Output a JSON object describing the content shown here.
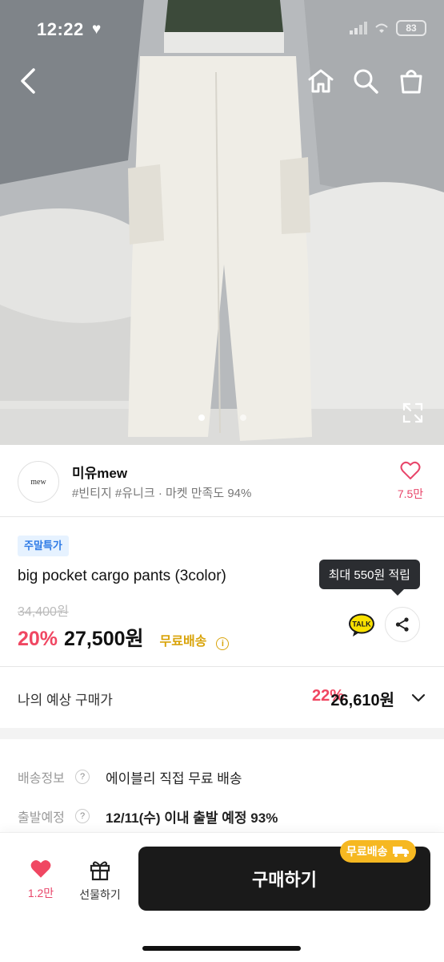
{
  "status_bar": {
    "time": "12:22",
    "battery": "83"
  },
  "seller": {
    "logo_text": "mew",
    "name": "미유mew",
    "tags": "#빈티지 #유니크 · 마켓 만족도 94%",
    "like_count": "7.5만"
  },
  "product": {
    "badge": "주말특가",
    "title": "big pocket cargo pants (3color)",
    "original_price": "34,400원",
    "discount": "20%",
    "price": "27,500원",
    "shipping_tag": "무료배송",
    "tooltip": "최대 550원 적립",
    "talk_label": "TALK"
  },
  "expected_price": {
    "label": "나의 예상 구매가",
    "discount": "22%",
    "price": "26,610원"
  },
  "shipping": [
    {
      "label": "배송정보",
      "value": "에이블리 직접 무료 배송"
    },
    {
      "label": "출발예정",
      "value": "12/11(수) 이내 출발 예정 93%"
    }
  ],
  "bottom_bar": {
    "like_count": "1.2만",
    "gift_label": "선물하기",
    "buy_label": "구매하기",
    "free_badge": "무료배송"
  },
  "colors": {
    "accent_pink": "#f04762",
    "badge_blue": "#2f7be6",
    "shipping_gold": "#d9a40b",
    "button_dark": "#1a1a1a"
  }
}
